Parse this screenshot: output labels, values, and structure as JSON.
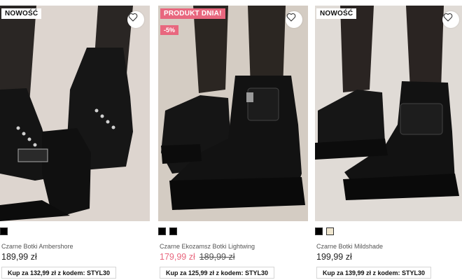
{
  "products": [
    {
      "badge": "NOWOŚĆ",
      "swatches": [
        "#000000"
      ],
      "name": "Czarne Botki Ambershore",
      "price": "189,99 zł",
      "promo": "Kup za 132,99 zł z kodem: STYL30"
    },
    {
      "badge": "PRODUKT DNIA!",
      "discount": "-5%",
      "swatches": [
        "#000000",
        "#000000"
      ],
      "name": "Czarne Ekozamsz Botki Lightwing",
      "price": "179,99 zł",
      "old_price": "189,99 zł",
      "promo": "Kup za 125,99 zł z kodem: STYL30"
    },
    {
      "badge": "NOWOŚĆ",
      "swatches": [
        "#000000",
        "#efe6cf"
      ],
      "name": "Czarne Botki Mildshade",
      "price": "199,99 zł",
      "promo": "Kup za 139,99 zł z kodem: STYL30"
    }
  ],
  "colors": {
    "accent": "#e8677e",
    "text": "#222222"
  },
  "icons": {
    "wishlist": "heart-outline-icon"
  }
}
